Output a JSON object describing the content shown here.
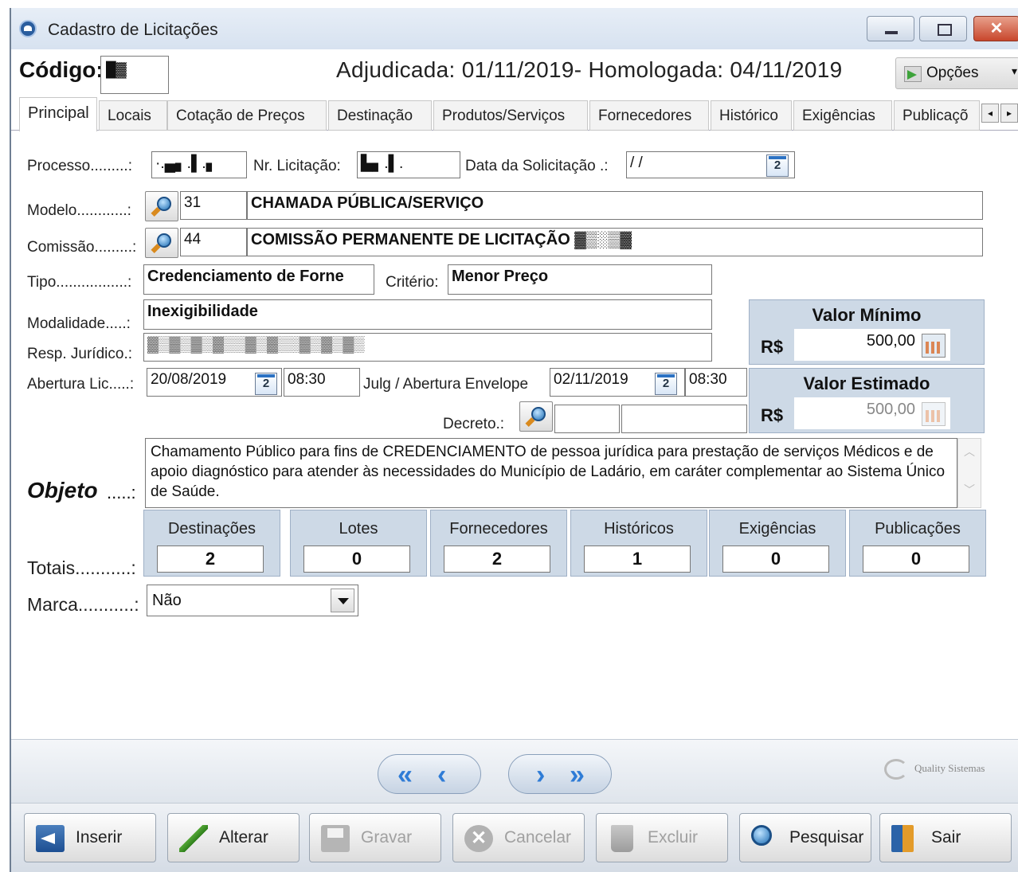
{
  "window": {
    "title": "Cadastro de Licitações",
    "close_glyph": "✕"
  },
  "header": {
    "codigo_label": "Código:",
    "codigo_value": "█▓",
    "dates_text": "Adjudicada: 01/11/2019- Homologada: 04/11/2019",
    "options_label": "Opções",
    "options_caret": "▾"
  },
  "tabs": [
    "Principal",
    "Locais",
    "Cotação de Preços",
    "Destinação",
    "Produtos/Serviços",
    "Fornecedores",
    "Histórico",
    "Exigências",
    "Publicaçõ"
  ],
  "tab_scroll": {
    "left": "◂",
    "right": "▸"
  },
  "form": {
    "processo_label": "Processo.........:",
    "processo_value": "·.▄▖.▌.▖",
    "nr_licitacao_label": "Nr. Licitação:",
    "nr_licitacao_value": "▙▖.▌.",
    "data_solicitacao_label": "Data da Solicitação .:",
    "data_solicitacao_value": " / /",
    "calendar_day": "2",
    "modelo_label": "Modelo............:",
    "modelo_code": "31",
    "modelo_desc": "CHAMADA PÚBLICA/SERVIÇO",
    "comissao_label": "Comissão.........:",
    "comissao_code": "44",
    "comissao_desc": "COMISSÃO PERMANENTE DE LICITAÇÃO ▓▒░▒▓",
    "tipo_label": "Tipo.................:",
    "tipo_value": "Credenciamento de Forne",
    "criterio_label": "Critério:",
    "criterio_value": "Menor Preço",
    "modalidade_label": "Modalidade.....:",
    "modalidade_value": "Inexigibilidade",
    "resp_label": "Resp. Jurídico.:",
    "resp_value": "▓▒▓▒▓▒▓▒▒▓▒▓▒▒▓▒▓▒▓▒",
    "abertura_label": "Abertura Lic.....:",
    "abertura_date": "20/08/2019",
    "abertura_time": "08:30",
    "julg_label": "Julg / Abertura Envelope",
    "julg_date": "02/11/2019",
    "julg_time": "08:30",
    "decreto_label": "Decreto.:",
    "decreto_value1": "",
    "decreto_value2": ""
  },
  "valores": {
    "minimo_title": "Valor Mínimo",
    "minimo_currency": "R$",
    "minimo_value": "500,00",
    "estimado_title": "Valor Estimado",
    "estimado_currency": "R$",
    "estimado_value": "500,00"
  },
  "objeto": {
    "label": "Objeto",
    "dots": ".....:",
    "text": "Chamamento Público para fins de CREDENCIAMENTO de pessoa jurídica para prestação de serviços Médicos e de apoio diagnóstico para atender às necessidades do Município de Ladário, em caráter complementar ao Sistema Único de Saúde.",
    "scroll_up": "︿",
    "scroll_down": "﹀"
  },
  "totais": {
    "label": "Totais...........:",
    "items": [
      {
        "label": "Destinações",
        "value": "2"
      },
      {
        "label": "Lotes",
        "value": "0"
      },
      {
        "label": "Fornecedores",
        "value": "2"
      },
      {
        "label": "Históricos",
        "value": "1"
      },
      {
        "label": "Exigências",
        "value": "0"
      },
      {
        "label": "Publicações",
        "value": "0"
      }
    ]
  },
  "marca": {
    "label": "Marca...........:",
    "value": "Não"
  },
  "nav": {
    "first": "«",
    "prev": "‹",
    "next": "›",
    "last": "»",
    "brand": "Quality Sistemas"
  },
  "buttons": {
    "inserir": "Inserir",
    "alterar": "Alterar",
    "gravar": "Gravar",
    "cancelar": "Cancelar",
    "cancelar_glyph": "✕",
    "excluir": "Excluir",
    "pesquisar": "Pesquisar",
    "sair": "Sair"
  }
}
